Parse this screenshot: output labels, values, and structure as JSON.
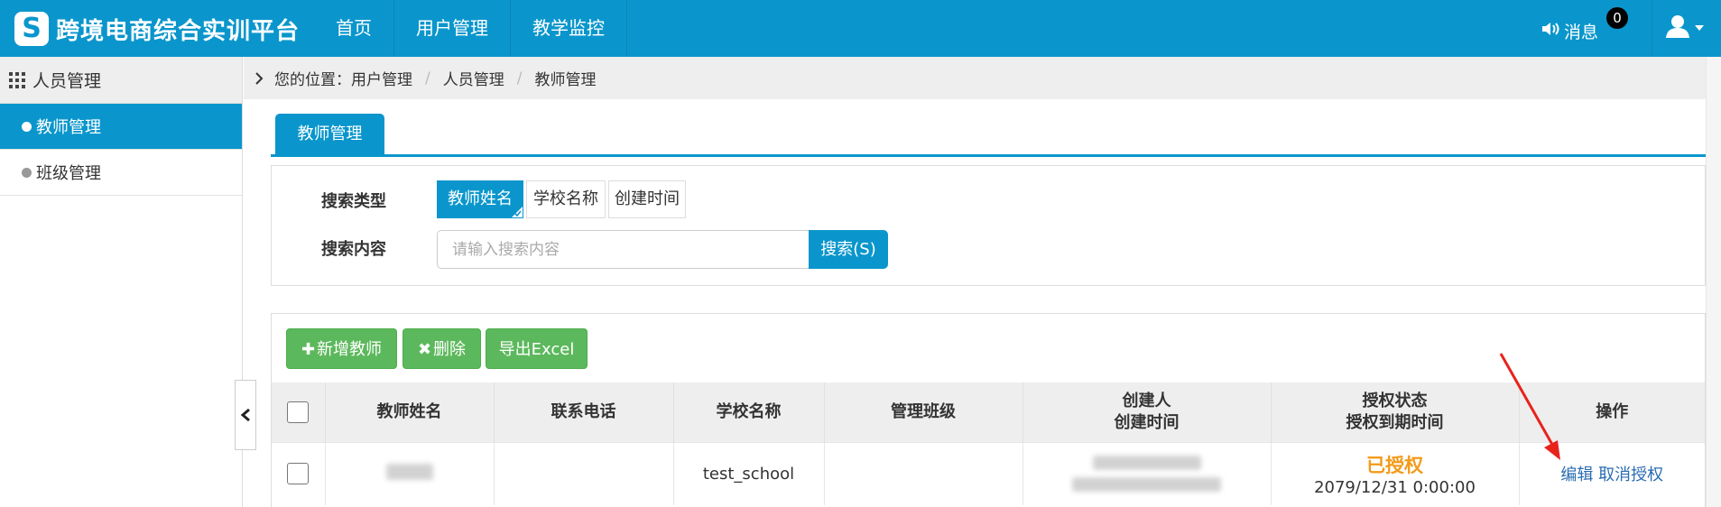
{
  "app": {
    "title": "跨境电商综合实训平台"
  },
  "nav": {
    "items": [
      "首页",
      "用户管理",
      "教学监控"
    ]
  },
  "header": {
    "messages_label": "消息",
    "messages_count": "0"
  },
  "sidebar": {
    "header": "人员管理",
    "items": [
      {
        "label": "教师管理",
        "active": true
      },
      {
        "label": "班级管理",
        "active": false
      }
    ]
  },
  "breadcrumb": {
    "prefix": "您的位置：",
    "items": [
      "用户管理",
      "人员管理",
      "教师管理"
    ]
  },
  "tab": {
    "label": "教师管理"
  },
  "search": {
    "type_label": "搜索类型",
    "content_label": "搜索内容",
    "types": [
      {
        "label": "教师姓名",
        "selected": true
      },
      {
        "label": "学校名称",
        "selected": false
      },
      {
        "label": "创建时间",
        "selected": false
      }
    ],
    "placeholder": "请输入搜索内容",
    "button": "搜索(S)"
  },
  "toolbar": {
    "add": "新增教师",
    "delete": "删除",
    "export": "导出Excel"
  },
  "table": {
    "headers": {
      "name": "教师姓名",
      "phone": "联系电话",
      "school": "学校名称",
      "classes": "管理班级",
      "creator": "创建人",
      "created": "创建时间",
      "auth": "授权状态",
      "expire": "授权到期时间",
      "ops": "操作"
    },
    "rows": [
      {
        "school": "test_school",
        "phone": "",
        "classes": "",
        "auth_status": "已授权",
        "expire": "2079/12/31 0:00:00",
        "edit": "编辑",
        "revoke": "取消授权"
      }
    ]
  },
  "colors": {
    "primary": "#0a96cc",
    "green": "#5cb85c",
    "auth": "#f29b1b",
    "link": "#2a6cb1",
    "arrow": "#e8231b"
  }
}
